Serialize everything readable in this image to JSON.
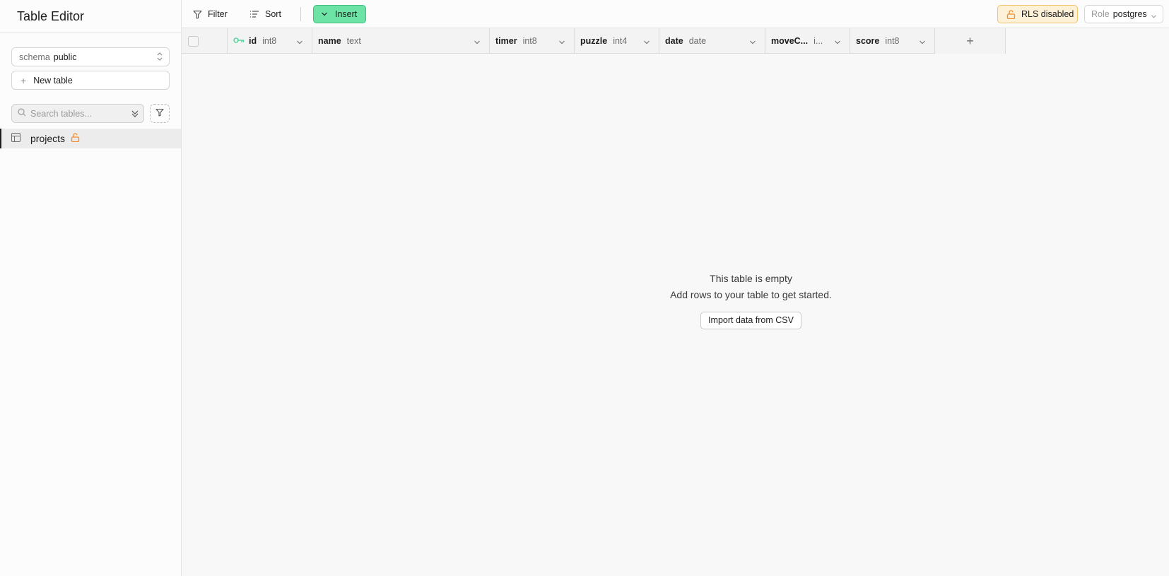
{
  "sidebar": {
    "title": "Table Editor",
    "schema": {
      "label": "schema",
      "value": "public"
    },
    "new_table_label": "New table",
    "search": {
      "placeholder": "Search tables..."
    },
    "tables": [
      {
        "name": "projects",
        "rls_icon": "unlock-icon"
      }
    ]
  },
  "toolbar": {
    "filter_label": "Filter",
    "sort_label": "Sort",
    "insert_label": "Insert",
    "rls_label": "RLS disabled",
    "role": {
      "label": "Role",
      "value": "postgres"
    }
  },
  "grid": {
    "columns": [
      {
        "name": "id",
        "type": "int8",
        "primary_key": true
      },
      {
        "name": "name",
        "type": "text"
      },
      {
        "name": "timer",
        "type": "int8"
      },
      {
        "name": "puzzle",
        "type": "int4"
      },
      {
        "name": "date",
        "type": "date"
      },
      {
        "name": "moveC...",
        "type": "i..."
      },
      {
        "name": "score",
        "type": "int8"
      }
    ],
    "add_column_label": "+"
  },
  "empty_state": {
    "title": "This table is empty",
    "subtitle": "Add rows to your table to get started.",
    "import_label": "Import data from CSV"
  },
  "colors": {
    "insert_bg": "#6ee3a6",
    "rls_bg": "#fdf1d8",
    "key_green": "#3ecf8e",
    "lock_orange": "#f08c2b"
  }
}
